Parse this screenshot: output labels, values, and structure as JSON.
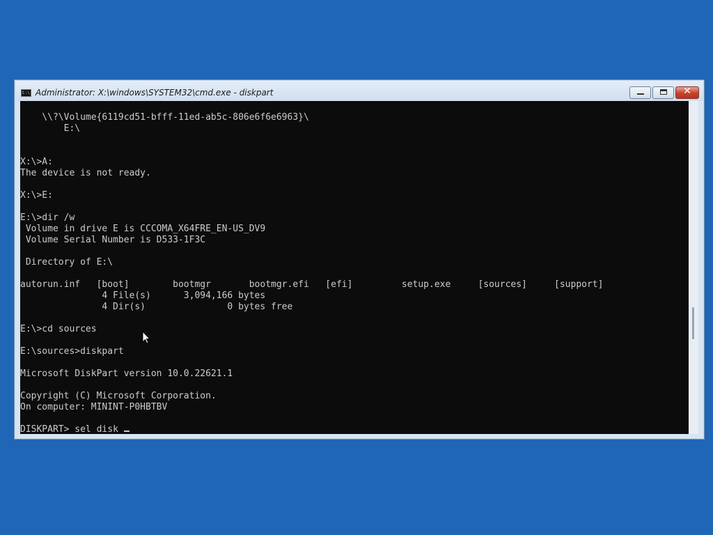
{
  "window": {
    "title": "Administrator: X:\\windows\\SYSTEM32\\cmd.exe - diskpart",
    "icon": "cmd-icon",
    "controls": {
      "minimize": "minimize-icon",
      "maximize": "maximize-icon",
      "close": "close-icon"
    }
  },
  "console": {
    "lines": [
      "    \\\\?\\Volume{6119cd51-bfff-11ed-ab5c-806e6f6e6963}\\",
      "        E:\\",
      "",
      "",
      "X:\\>A:",
      "The device is not ready.",
      "",
      "X:\\>E:",
      "",
      "E:\\>dir /w",
      " Volume in drive E is CCCOMA_X64FRE_EN-US_DV9",
      " Volume Serial Number is D533-1F3C",
      "",
      " Directory of E:\\",
      "",
      "autorun.inf   [boot]        bootmgr       bootmgr.efi   [efi]         setup.exe     [sources]     [support]",
      "               4 File(s)      3,094,166 bytes",
      "               4 Dir(s)               0 bytes free",
      "",
      "E:\\>cd sources",
      "",
      "E:\\sources>diskpart",
      "",
      "Microsoft DiskPart version 10.0.22621.1",
      "",
      "Copyright (C) Microsoft Corporation.",
      "On computer: MININT-P0HBTBV",
      ""
    ],
    "prompt": "DISKPART> ",
    "input": "sel disk "
  },
  "colors": {
    "desktop": "#1f66b6",
    "console_bg": "#0c0c0c",
    "console_fg": "#cccccc",
    "close_button": "#c5432d"
  }
}
